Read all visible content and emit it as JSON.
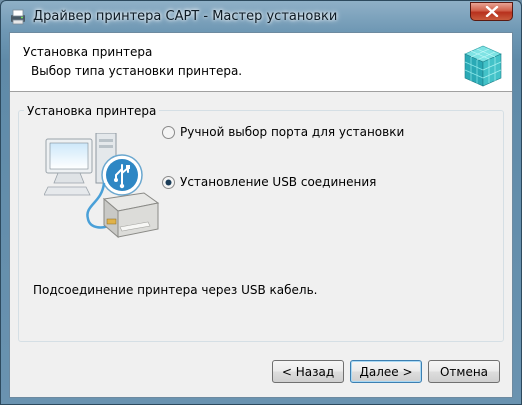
{
  "window": {
    "title": "Драйвер принтера CAPT - Мастер установки"
  },
  "header": {
    "title": "Установка принтера",
    "subtitle": "Выбор типа установки принтера."
  },
  "group": {
    "label": "Установка принтера",
    "options": [
      {
        "label": "Ручной выбор порта для установки",
        "selected": false
      },
      {
        "label": "Установление USB соединения",
        "selected": true
      }
    ],
    "description": "Подсоединение принтера через USB кабель."
  },
  "buttons": {
    "back": "< Назад",
    "next": "Далее >",
    "cancel": "Отмена"
  },
  "colors": {
    "accent": "#3c7fb1",
    "close": "#c0432c"
  }
}
